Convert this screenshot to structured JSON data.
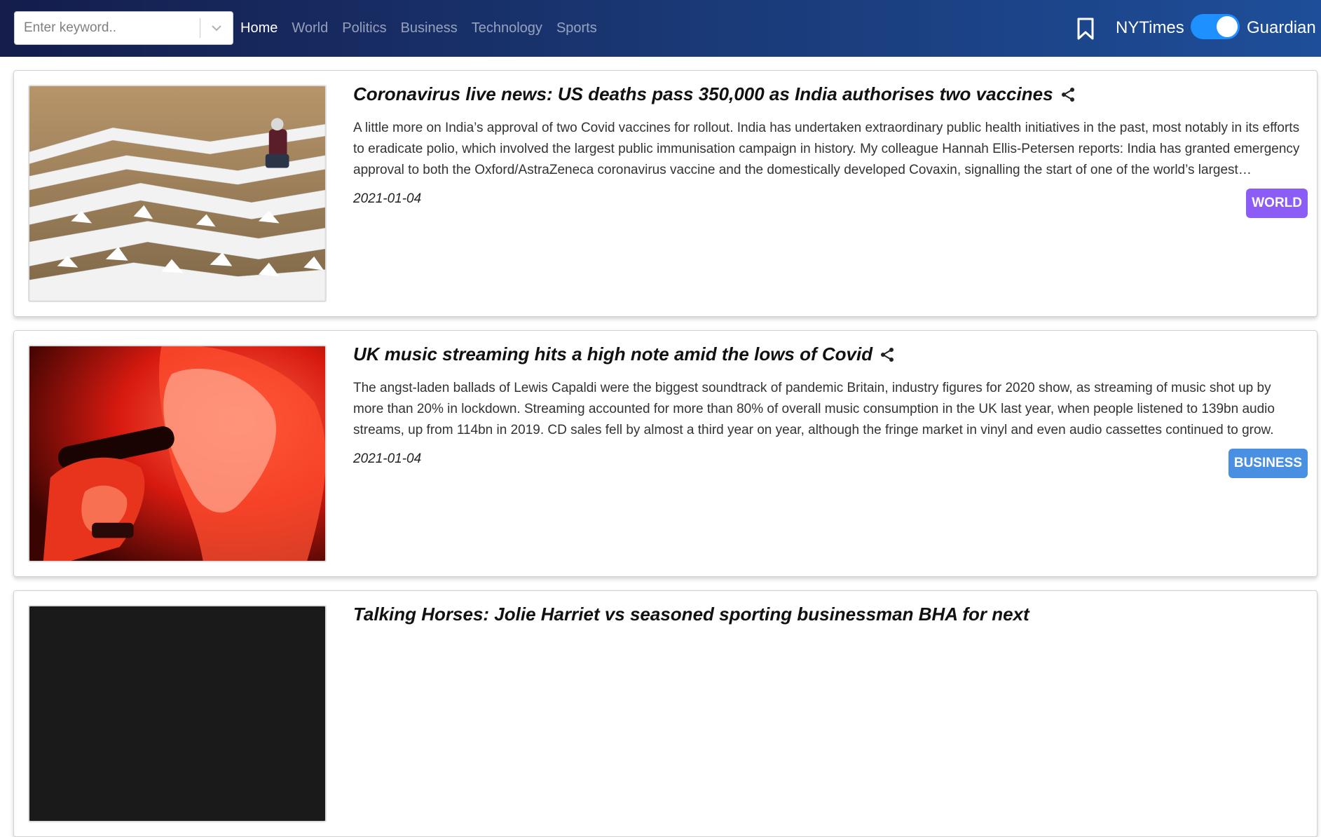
{
  "navbar": {
    "search": {
      "placeholder": "Enter keyword.."
    },
    "links": [
      "Home",
      "World",
      "Politics",
      "Business",
      "Technology",
      "Sports"
    ],
    "active_link": "Home",
    "source_left": "NYTimes",
    "source_right": "Guardian",
    "toggle_state": "Guardian"
  },
  "articles": [
    {
      "title": "Coronavirus live news: US deaths pass 350,000 as India authorises two vaccines",
      "description": "A little more on India’s approval of two Covid vaccines for rollout. India has undertaken extraordinary public health initiatives in the past, most notably in its efforts to eradicate polio, which involved the largest public immunisation campaign in history. My colleague Hannah Ellis-Petersen reports: India has granted emergency approval to both the Oxford/AstraZeneca coronavirus vaccine and the domestically developed Covaxin, signalling the start of one of the world’s largest vaccination drives.",
      "date": "2021-01-04",
      "section": "WORLD",
      "section_color": "#8b5cf6"
    },
    {
      "title": "UK music streaming hits a high note amid the lows of Covid",
      "description": "The angst-laden ballads of Lewis Capaldi were the biggest soundtrack of pandemic Britain, industry figures for 2020 show, as streaming of music shot up by more than 20% in lockdown. Streaming accounted for more than 80% of overall music consumption in the UK last year, when people listened to 139bn audio streams, up from 114bn in 2019. CD sales fell by almost a third year on year, although the fringe market in vinyl and even audio cassettes continued to grow.",
      "date": "2021-01-04",
      "section": "BUSINESS",
      "section_color": "#4a90e2"
    },
    {
      "title": "Talking Horses: Jolie Harriet vs seasoned sporting businessman BHA for next"
    }
  ],
  "icons": {
    "chevron": "chevron-down-icon",
    "bookmark": "bookmark-icon",
    "share": "share-icon"
  }
}
